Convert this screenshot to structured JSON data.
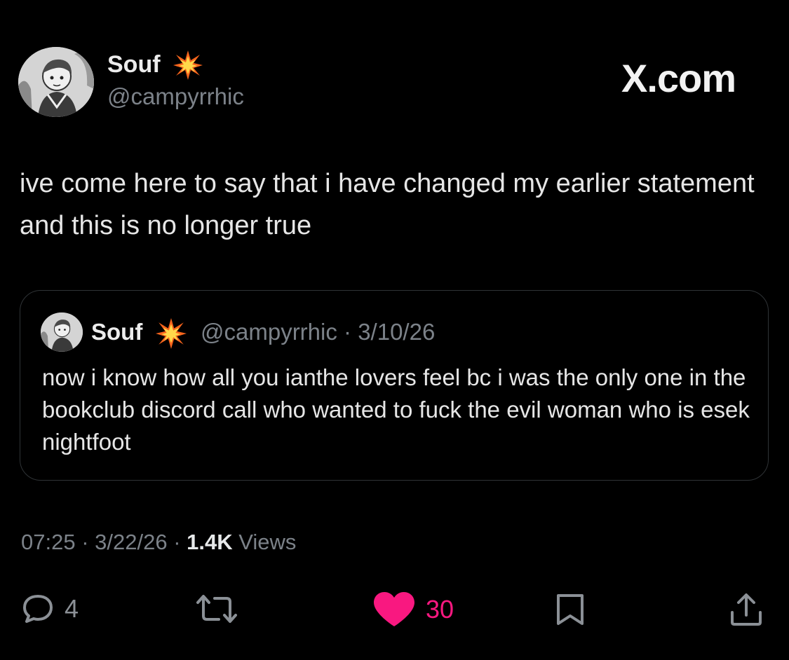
{
  "author": {
    "display_name": "Souf",
    "handle": "@campyrrhic",
    "badge_icon": "collision-burst-icon"
  },
  "brand": {
    "logo_text": "X.com"
  },
  "post": {
    "text": "ive come here to say that i have changed my earlier statement and this is no longer true"
  },
  "quoted_post": {
    "display_name": "Souf",
    "handle": "@campyrrhic",
    "separator": "·",
    "date": "3/10/26",
    "text": "now i know how all you ianthe lovers feel bc i was the only one in the bookclub discord call who wanted to fuck the evil woman who is esek nightfoot"
  },
  "meta": {
    "time": "07:25",
    "separator": "·",
    "date": "3/22/26",
    "views_count": "1.4K",
    "views_label": "Views"
  },
  "actions": {
    "replies": "4",
    "likes": "30"
  },
  "colors": {
    "background": "#000000",
    "text": "#e7e9ea",
    "muted": "#7c8289",
    "like_accent": "#f91880",
    "border": "#2f3336"
  }
}
